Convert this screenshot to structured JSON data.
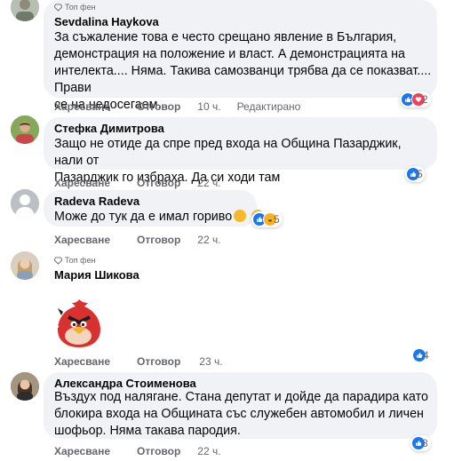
{
  "comments": [
    {
      "badge": "Топ фен",
      "name": "Sevdalina Haykova",
      "text": "За съжаление това е често срещано явление в България,\nдемонстрация на положение и власт. А демонстрацията на\nинтелекта.... Няма. Такива самозванци трябва да се показват.... Прави\nсе на недосегаем...",
      "like": "Харесване",
      "reply": "Отговор",
      "time": "10 ч.",
      "edited": "Редактирано",
      "reaction_count": "2"
    },
    {
      "name": "Стефка Димитрова",
      "text": "Защо не отиде да спре пред входа на Община Пазарджик, нали от\nПазарджик го избраха. Да си ходи там",
      "like": "Харесване",
      "reply": "Отговор",
      "time": "22 ч.",
      "reaction_count": "5"
    },
    {
      "name": "Radeva Radeva",
      "text": "Може до тук да е имал гориво",
      "like": "Харесване",
      "reply": "Отговор",
      "time": "22 ч.",
      "reaction_count": "5"
    },
    {
      "badge": "Топ фен",
      "name": "Мария Шикова",
      "like": "Харесване",
      "reply": "Отговор",
      "time": "23 ч.",
      "reaction_count": "4"
    },
    {
      "name": "Александра Стоименова",
      "text": "Въздух под налягане. Стана депутат и дойде да парадира като\nблокира входа на Общината със служебен автомобил и личен\nшофьор. Няма такава пародия.",
      "like": "Харесване",
      "reply": "Отговор",
      "time": "22 ч.",
      "reaction_count": "8"
    }
  ],
  "colors": {
    "bubble": "#f0f2f5",
    "meta": "#65676b",
    "like_blue": "#1877f2",
    "love_red": "#f33e58",
    "haha_yellow": "#f7b125"
  }
}
